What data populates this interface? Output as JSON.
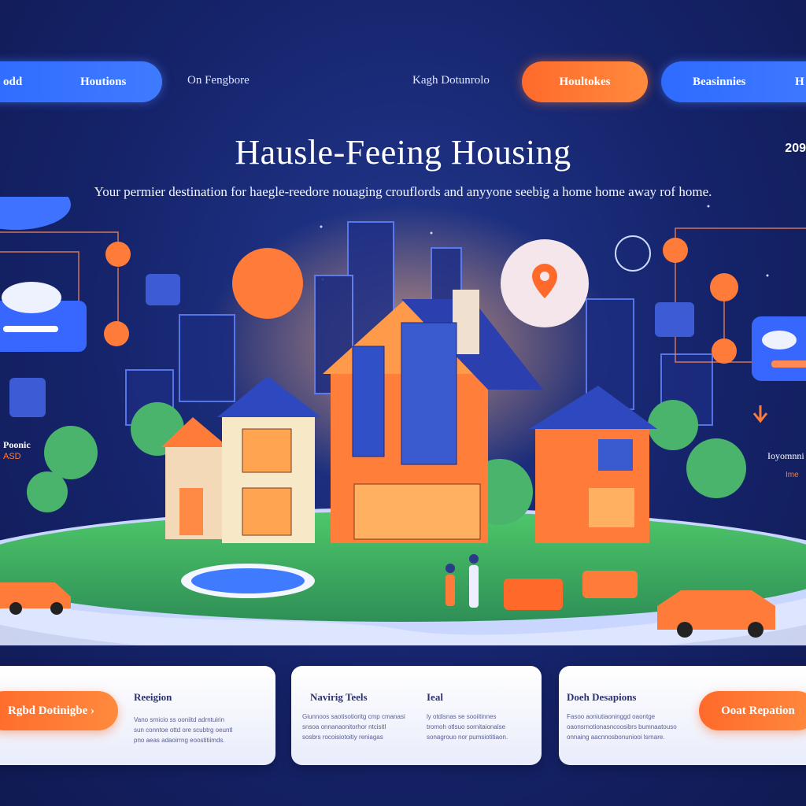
{
  "nav": {
    "item_left": "odd",
    "item_housing": "Houtions",
    "item_text1": "On Fengbore",
    "item_text2": "Kagh Dotunrolo",
    "item_active": "Houltokes",
    "item_blue2": "Beasinnies",
    "item_cut": "H"
  },
  "hero": {
    "title": "Hausle-Feeing Housing",
    "subtitle": "Your permier destination for haegle-reedore nouaging crouflords and anyyone seebig a home home away rof home.",
    "corner_number": "209"
  },
  "side": {
    "left_label": "Poonic",
    "left_value": "ASD",
    "right_label": "Ioyomnni",
    "right_value": "Ime"
  },
  "cards": [
    {
      "heading": "Reeigion",
      "cta": "Rgbd Dotinigbe ›",
      "lines": [
        "Vano srnicio ss ooniitd adrntuirin",
        "sun conntoe ottd ore scubtrg oeuntl",
        "pno aeas adaoirrng eoostitiimds."
      ]
    },
    {
      "heading": "Navirig Teels",
      "heading2": "Ieal",
      "lines": [
        "Giunnoos saotisotioritg cmp cmanasi",
        "snsoa onnanaonitorhor ntcisitl",
        "sosbrs rocoisiotoitiy reniagas"
      ],
      "lines2": [
        "ly otdisnas se sooiitinnes",
        "tromoh otlsuo sornitaionalse",
        "sonagrouo nor pumsiotitiaon."
      ]
    },
    {
      "heading": "Doeh Desapions",
      "cta": "Ooat Repation",
      "lines": [
        "Fasoo aoniutiaoninggd oaontge",
        "oaonsrnotionasncoosibrs bumnaatouso",
        "onnaing aacnnosbonuniooi lsrnare."
      ]
    }
  ],
  "colors": {
    "background": "#15236a",
    "accent_orange": "#ff6a2b",
    "accent_blue": "#2f6bff"
  }
}
